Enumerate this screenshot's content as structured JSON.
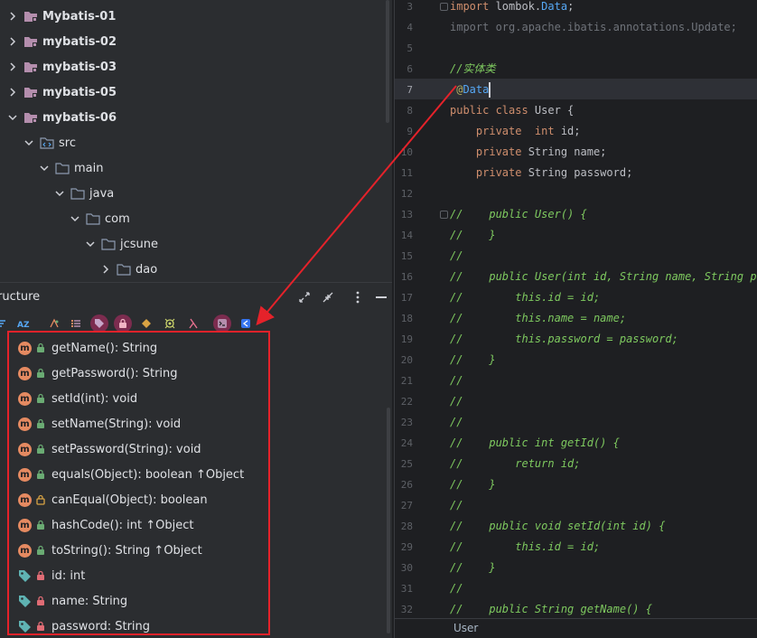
{
  "project_tree": {
    "rows": [
      {
        "label": "Mybatis-01",
        "kind": "module",
        "expanded": false
      },
      {
        "label": "mybatis-02",
        "kind": "module",
        "expanded": false
      },
      {
        "label": "mybatis-03",
        "kind": "module",
        "expanded": false
      },
      {
        "label": "mybatis-05",
        "kind": "module",
        "expanded": false
      },
      {
        "label": "mybatis-06",
        "kind": "module",
        "expanded": true
      },
      {
        "label": "src",
        "kind": "source-folder",
        "expanded": true
      },
      {
        "label": "main",
        "kind": "folder",
        "expanded": true
      },
      {
        "label": "java",
        "kind": "folder",
        "expanded": true
      },
      {
        "label": "com",
        "kind": "folder",
        "expanded": true
      },
      {
        "label": "jcsune",
        "kind": "folder",
        "expanded": true
      },
      {
        "label": "dao",
        "kind": "folder",
        "expanded": false
      }
    ]
  },
  "structure": {
    "title": "ructure",
    "members": [
      {
        "kind": "method",
        "access": "public",
        "label": "getName(): String"
      },
      {
        "kind": "method",
        "access": "public",
        "label": "getPassword(): String"
      },
      {
        "kind": "method",
        "access": "public",
        "label": "setId(int): void"
      },
      {
        "kind": "method",
        "access": "public",
        "label": "setName(String): void"
      },
      {
        "kind": "method",
        "access": "public",
        "label": "setPassword(String): void"
      },
      {
        "kind": "method",
        "access": "public",
        "label": "equals(Object): boolean ↑Object"
      },
      {
        "kind": "method",
        "access": "protected",
        "label": "canEqual(Object): boolean"
      },
      {
        "kind": "method",
        "access": "public",
        "label": "hashCode(): int ↑Object"
      },
      {
        "kind": "method",
        "access": "public",
        "label": "toString(): String ↑Object"
      },
      {
        "kind": "field",
        "access": "private",
        "label": "id: int"
      },
      {
        "kind": "field",
        "access": "private",
        "label": "name: String"
      },
      {
        "kind": "field",
        "access": "private",
        "label": "password: String"
      }
    ]
  },
  "editor": {
    "current_line": 7,
    "lines": [
      {
        "n": "3",
        "tokens": [
          [
            "kw",
            "import"
          ],
          [
            "cls",
            " lombok."
          ],
          [
            "cnst",
            "Data"
          ],
          [
            "cls",
            ";"
          ]
        ]
      },
      {
        "n": "4",
        "tokens": [
          [
            "pkg",
            "import org.apache.ibatis.annotations.Update;"
          ]
        ]
      },
      {
        "n": "5",
        "tokens": []
      },
      {
        "n": "6",
        "tokens": [
          [
            "cm",
            "//实体类"
          ]
        ]
      },
      {
        "n": "7",
        "tokens": [
          [
            "ann",
            " @"
          ],
          [
            "cnst",
            "Data"
          ]
        ]
      },
      {
        "n": "8",
        "tokens": [
          [
            "kw",
            "public class"
          ],
          [
            "cls",
            " User {"
          ]
        ]
      },
      {
        "n": "9",
        "tokens": [
          [
            "kw",
            "    private  int"
          ],
          [
            "cls",
            " id;"
          ]
        ]
      },
      {
        "n": "10",
        "tokens": [
          [
            "kw",
            "    private"
          ],
          [
            "cls",
            " String name;"
          ]
        ]
      },
      {
        "n": "11",
        "tokens": [
          [
            "kw",
            "    private"
          ],
          [
            "cls",
            " String password;"
          ]
        ]
      },
      {
        "n": "12",
        "tokens": []
      },
      {
        "n": "13",
        "tokens": [
          [
            "cm",
            "//    public User() {"
          ]
        ]
      },
      {
        "n": "14",
        "tokens": [
          [
            "cm",
            "//    }"
          ]
        ]
      },
      {
        "n": "15",
        "tokens": [
          [
            "cm",
            "//"
          ]
        ]
      },
      {
        "n": "16",
        "tokens": [
          [
            "cm",
            "//    public User(int id, String name, String pas"
          ]
        ]
      },
      {
        "n": "17",
        "tokens": [
          [
            "cm",
            "//        this.id = id;"
          ]
        ]
      },
      {
        "n": "18",
        "tokens": [
          [
            "cm",
            "//        this.name = name;"
          ]
        ]
      },
      {
        "n": "19",
        "tokens": [
          [
            "cm",
            "//        this.password = password;"
          ]
        ]
      },
      {
        "n": "20",
        "tokens": [
          [
            "cm",
            "//    }"
          ]
        ]
      },
      {
        "n": "21",
        "tokens": [
          [
            "cm",
            "//"
          ]
        ]
      },
      {
        "n": "22",
        "tokens": [
          [
            "cm",
            "//"
          ]
        ]
      },
      {
        "n": "23",
        "tokens": [
          [
            "cm",
            "//"
          ]
        ]
      },
      {
        "n": "24",
        "tokens": [
          [
            "cm",
            "//    public int getId() {"
          ]
        ]
      },
      {
        "n": "25",
        "tokens": [
          [
            "cm",
            "//        return id;"
          ]
        ]
      },
      {
        "n": "26",
        "tokens": [
          [
            "cm",
            "//    }"
          ]
        ]
      },
      {
        "n": "27",
        "tokens": [
          [
            "cm",
            "//"
          ]
        ]
      },
      {
        "n": "28",
        "tokens": [
          [
            "cm",
            "//    public void setId(int id) {"
          ]
        ]
      },
      {
        "n": "29",
        "tokens": [
          [
            "cm",
            "//        this.id = id;"
          ]
        ]
      },
      {
        "n": "30",
        "tokens": [
          [
            "cm",
            "//    }"
          ]
        ]
      },
      {
        "n": "31",
        "tokens": [
          [
            "cm",
            "//"
          ]
        ]
      },
      {
        "n": "32",
        "tokens": [
          [
            "cm",
            "//    public String getName() {"
          ]
        ]
      }
    ],
    "breadcrumb": "User"
  },
  "colors": {
    "highlight": "#e5222a",
    "method_badge": "#e58a61",
    "field_tag": "#5fb3b3",
    "lock_public": "#6aab73",
    "lock_private": "#e06c75",
    "lock_protected": "#d9a343",
    "module_folder": "#b48ead",
    "folder": "#8c9aaf"
  }
}
